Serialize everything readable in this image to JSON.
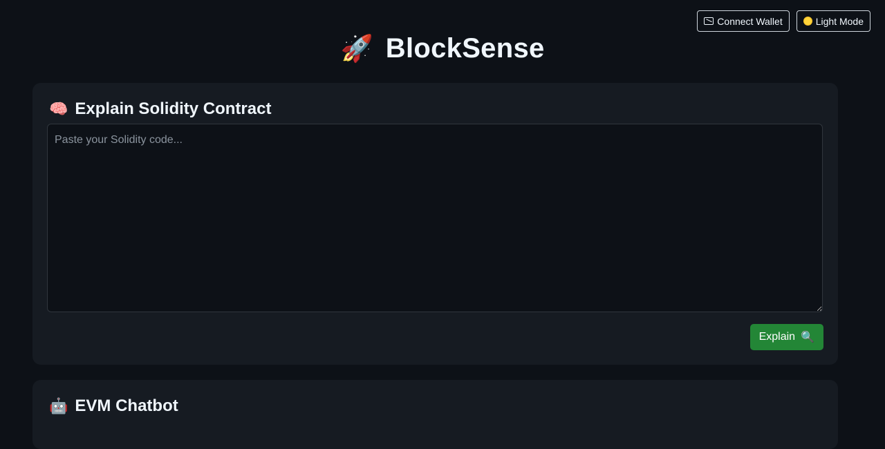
{
  "header": {
    "connect_wallet_label": "Connect Wallet",
    "connect_wallet_icon": "wallet-icon",
    "light_mode_label": "Light Mode",
    "light_mode_icon": "sun-icon"
  },
  "brand": {
    "icon": "🚀",
    "title": "BlockSense"
  },
  "explain_card": {
    "icon": "🧠",
    "title": "Explain Solidity Contract",
    "placeholder": "Paste your Solidity code...",
    "value": "",
    "button_label": "Explain",
    "button_icon": "🔍"
  },
  "chatbot_card": {
    "icon": "🤖",
    "title": "EVM Chatbot"
  },
  "colors": {
    "background": "#0d1117",
    "card": "#161b22",
    "accent_green": "#238636",
    "border": "#30363d"
  }
}
